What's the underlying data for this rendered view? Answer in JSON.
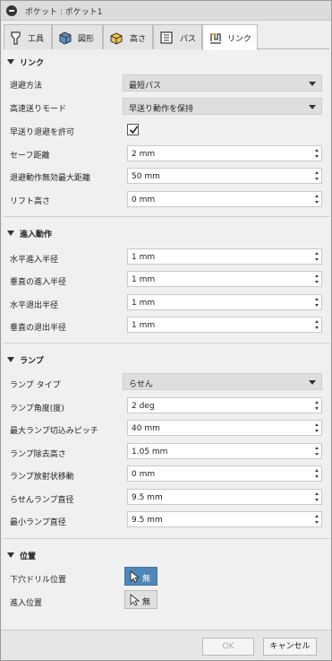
{
  "title": "ポケット : ポケット1",
  "tabs": [
    {
      "label": "工具",
      "icon": "tool-icon"
    },
    {
      "label": "図形",
      "icon": "geometry-icon"
    },
    {
      "label": "高さ",
      "icon": "heights-icon"
    },
    {
      "label": "パス",
      "icon": "passes-icon"
    },
    {
      "label": "リンク",
      "icon": "linking-icon",
      "active": true
    }
  ],
  "link": {
    "header": "リンク",
    "retraction_label": "退避方法",
    "retraction_value": "最短パス",
    "highfeed_label": "高速送りモード",
    "highfeed_value": "早送り動作を保持",
    "allow_rapid_label": "早送り退避を許可",
    "allow_rapid_checked": true,
    "safe_distance_label": "セーフ距離",
    "safe_distance_value": "2 mm",
    "max_stay_down_label": "退避動作無効最大距離",
    "max_stay_down_value": "50 mm",
    "lift_height_label": "リフト高さ",
    "lift_height_value": "0 mm"
  },
  "entry": {
    "header": "進入動作",
    "h_lead_in_label": "水平進入半径",
    "h_lead_in_value": "1 mm",
    "v_lead_in_label": "垂直の進入半径",
    "v_lead_in_value": "1 mm",
    "h_lead_out_label": "水平退出半径",
    "h_lead_out_value": "1 mm",
    "v_lead_out_label": "垂直の退出半径",
    "v_lead_out_value": "1 mm"
  },
  "ramp": {
    "header": "ランプ",
    "type_label": "ランプ タイプ",
    "type_value": "らせん",
    "angle_label": "ランプ角度(度)",
    "angle_value": "2 deg",
    "max_stepdown_label": "最大ランプ切込みピッチ",
    "max_stepdown_value": "40 mm",
    "clearance_label": "ランプ除去高さ",
    "clearance_value": "1.05 mm",
    "radial_label": "ランプ放射状移動",
    "radial_value": "0 mm",
    "helix_dia_label": "らせんランプ直径",
    "helix_dia_value": "9.5 mm",
    "min_dia_label": "最小ランプ直径",
    "min_dia_value": "9.5 mm"
  },
  "position": {
    "header": "位置",
    "predrill_label": "下穴ドリル位置",
    "predrill_value": "無",
    "entry_label": "進入位置",
    "entry_value": "無"
  },
  "footer": {
    "ok": "OK",
    "cancel": "キャンセル"
  }
}
